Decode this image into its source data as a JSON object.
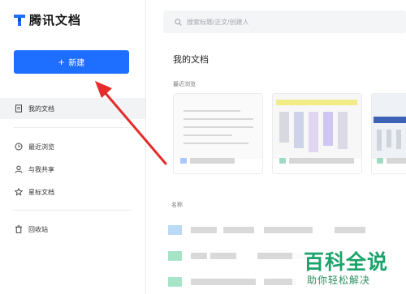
{
  "sidebar": {
    "logo_text": "腾讯文档",
    "new_button_label": "新建",
    "items": [
      {
        "label": "我的文档"
      },
      {
        "label": "最近浏览"
      },
      {
        "label": "与我共享"
      },
      {
        "label": "星标文档"
      },
      {
        "label": "回收站"
      }
    ]
  },
  "search": {
    "placeholder": "搜索标题/正文/创建人"
  },
  "main": {
    "title": "我的文档",
    "recent_label": "最近浏览",
    "name_header": "名称"
  },
  "watermark": {
    "main": "百科全说",
    "sub": "助你轻松解决"
  },
  "colors": {
    "accent": "#1e6fff",
    "annotation_arrow": "#e52b2b",
    "watermark_green": "#1aa36a"
  }
}
